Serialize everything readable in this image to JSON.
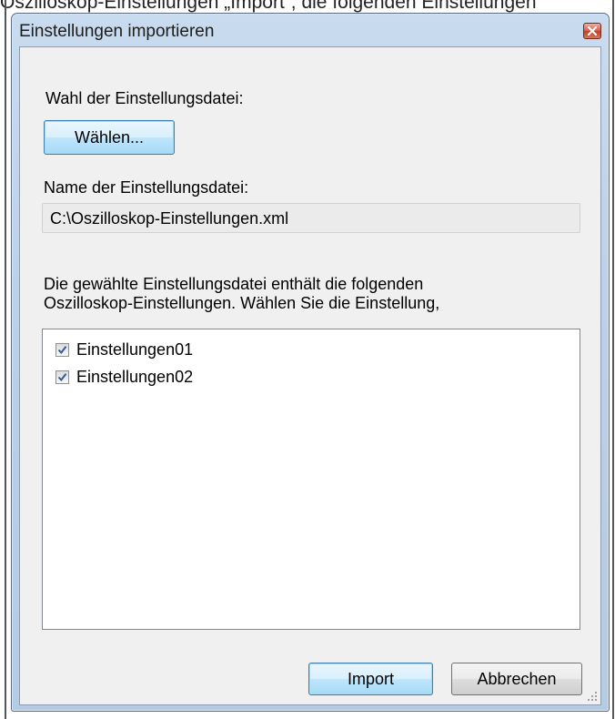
{
  "background_caption": "Oszilloskop-Einstellungen „Import“, die folgenden Einstellungen",
  "dialog": {
    "title": "Einstellungen importieren",
    "select_file_label": "Wahl der Einstellungsdatei:",
    "choose_button": "Wählen...",
    "filename_label": "Name der Einstellungsdatei:",
    "filename_value": "C:\\Oszilloskop-Einstellungen.xml",
    "description_line1": "Die gewählte Einstellungsdatei enthält die folgenden",
    "description_line2": "Oszilloskop-Einstellungen. Wählen Sie die Einstellung,",
    "settings": [
      {
        "label": "Einstellungen01",
        "checked": true
      },
      {
        "label": "Einstellungen02",
        "checked": true
      }
    ],
    "import_button": "Import",
    "cancel_button": "Abbrechen"
  },
  "colors": {
    "window_frame": "#bcd0e7",
    "client_background": "#f0f0f0",
    "close_button": "#c74a33",
    "checkmark": "#2f5b9a"
  }
}
